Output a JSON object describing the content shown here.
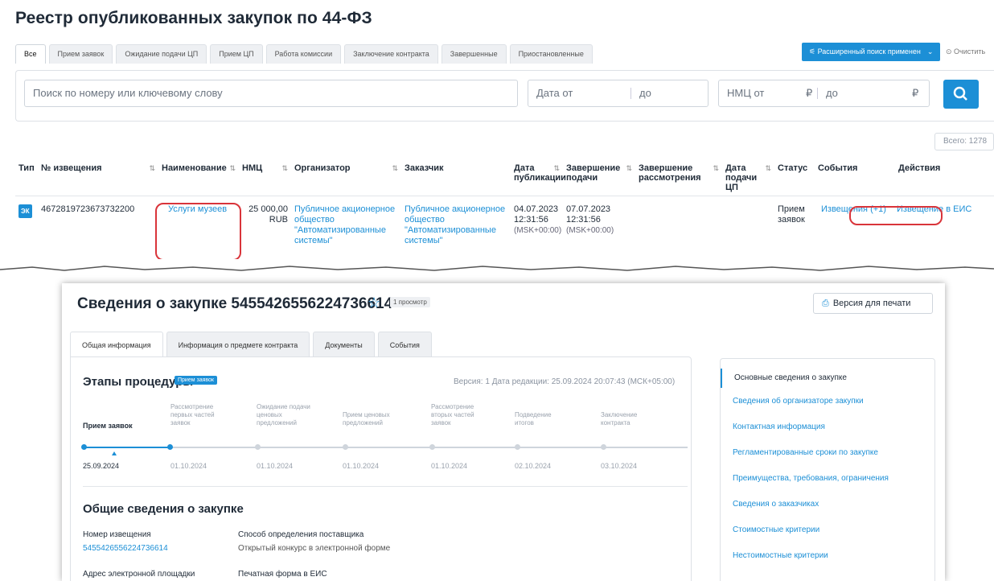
{
  "registry": {
    "title": "Реестр опубликованных закупок по 44-ФЗ",
    "tabs": [
      "Все",
      "Прием заявок",
      "Ожидание подачи ЦП",
      "Прием ЦП",
      "Работа комиссии",
      "Заключение контракта",
      "Завершенные",
      "Приостановленные"
    ],
    "advanced_search": "Расширенный поиск применен",
    "clear": "Очистить",
    "search_placeholder": "Поиск по номеру или ключевому слову",
    "date_from": "Дата от",
    "date_to": "до",
    "price_from": "НМЦ от",
    "price_to": "до",
    "currency": "₽",
    "total": "Всего: 1278",
    "columns": [
      "Тип",
      "№ извещения",
      "Наименование",
      "НМЦ",
      "Организатор",
      "Заказчик",
      "Дата публикации",
      "Завершение подачи",
      "Завершение рассмотрения",
      "Дата подачи ЦП",
      "Статус",
      "События",
      "Действия"
    ],
    "row": {
      "type": "ЭК",
      "number": "46728197236737322​00",
      "name": "Услуги музеев",
      "price": "25 000,00",
      "price_cur": "RUB",
      "organizer": "Публичное акционерное общество \"Автоматизированные системы\"",
      "customer": "Публичное акционерное общество \"Автоматизированные системы\"",
      "pub_date": "04.07.2023",
      "pub_time": "12:31:56",
      "pub_tz": "(MSK+00:00)",
      "end_date": "07.07.2023",
      "end_time": "12:31:56",
      "end_tz": "(MSK+00:00)",
      "status": "Прием заявок",
      "events": "Извещения (+1)",
      "action": "Извещение в ЕИС"
    }
  },
  "detail": {
    "title": "Сведения о закупке 5455426556224736614",
    "views": "1 просмотр",
    "print": "Версия для печати",
    "tabs": [
      "Общая информация",
      "Информация о предмете контракта",
      "Документы",
      "События"
    ],
    "stages_title": "Этапы процедуры",
    "stage_badge": "Прием заявок",
    "version": "Версия: 1 Дата редакции: 25.09.2024 20:07:43 (МСК+05:00)",
    "stages": [
      {
        "name": "Прием заявок",
        "date": "25.09.2024"
      },
      {
        "name": "Рассмотрение первых частей заявок",
        "date": "01.10.2024"
      },
      {
        "name": "Ожидание подачи ценовых предложений",
        "date": "01.10.2024"
      },
      {
        "name": "Прием ценовых предложений",
        "date": "01.10.2024"
      },
      {
        "name": "Рассмотрение вторых частей заявок",
        "date": "01.10.2024"
      },
      {
        "name": "Подведение итогов",
        "date": "02.10.2024"
      },
      {
        "name": "Заключение контракта",
        "date": "03.10.2024"
      }
    ],
    "general_title": "Общие сведения о закупке",
    "notice_label": "Номер извещения",
    "notice_value": "5455426556224736614",
    "method_label": "Способ определения поставщика",
    "method_value": "Открытый конкурс в электронной форме",
    "platform_label": "Адрес электронной площадки",
    "print_form_label": "Печатная форма в ЕИС",
    "nav": [
      "Основные сведения о закупке",
      "Сведения об организаторе закупки",
      "Контактная информация",
      "Регламентированные сроки по закупке",
      "Преимущества, требования, ограничения",
      "Сведения о заказчиках",
      "Стоимостные критерии",
      "Нестоимостные критерии"
    ]
  },
  "colors": {
    "accent": "#1c8fd6",
    "highlight": "#d9343a"
  }
}
